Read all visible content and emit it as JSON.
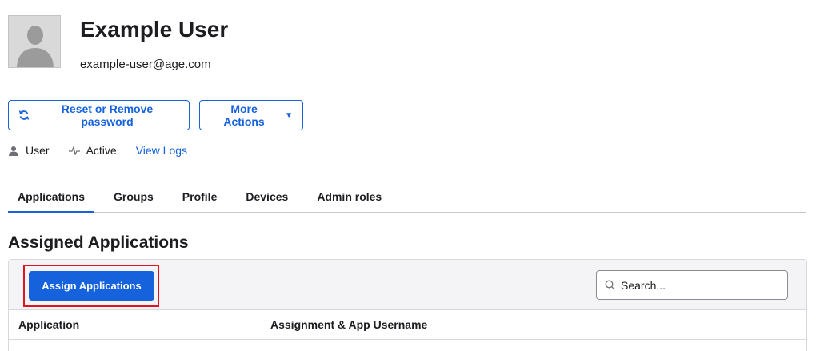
{
  "profile": {
    "name": "Example User",
    "email": "example-user@age.com",
    "avatar_icon": "user-silhouette-icon"
  },
  "actions": {
    "reset_label": "Reset or Remove password",
    "reset_icon": "refresh-icon",
    "more_label": "More Actions",
    "more_caret": "▼"
  },
  "status": {
    "type_label": "User",
    "type_icon": "user-icon",
    "state_label": "Active",
    "state_icon": "pulse-icon",
    "logs_link": "View Logs"
  },
  "tabs": [
    {
      "label": "Applications",
      "active": true
    },
    {
      "label": "Groups",
      "active": false
    },
    {
      "label": "Profile",
      "active": false
    },
    {
      "label": "Devices",
      "active": false
    },
    {
      "label": "Admin roles",
      "active": false
    }
  ],
  "section": {
    "title": "Assigned Applications",
    "assign_button": "Assign Applications",
    "search_placeholder": "Search..."
  },
  "table": {
    "columns": [
      "Application",
      "Assignment & App Username"
    ]
  },
  "colors": {
    "accent": "#1662dd",
    "highlight": "#e0141e"
  }
}
